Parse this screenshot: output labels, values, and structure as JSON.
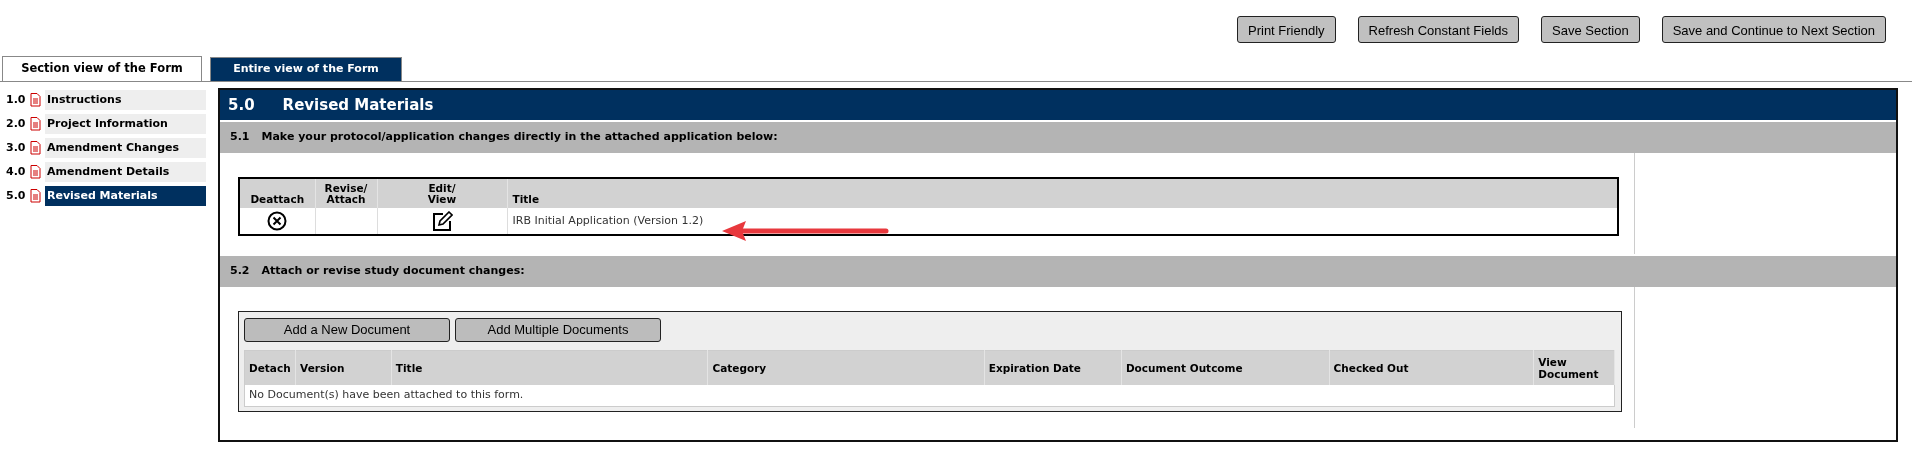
{
  "toolbar_buttons": [
    "Print Friendly",
    "Refresh Constant Fields",
    "Save Section",
    "Save and Continue to Next Section"
  ],
  "tabs": [
    {
      "label": "Section view of the Form",
      "selected": true
    },
    {
      "label": "Entire view of the Form",
      "selected": false
    }
  ],
  "sidebar": {
    "items": [
      {
        "number": "1.0",
        "label": "Instructions",
        "selected": false
      },
      {
        "number": "2.0",
        "label": "Project Information",
        "selected": false
      },
      {
        "number": "3.0",
        "label": "Amendment Changes",
        "selected": false
      },
      {
        "number": "4.0",
        "label": "Amendment Details",
        "selected": false
      },
      {
        "number": "5.0",
        "label": "Revised Materials",
        "selected": true
      }
    ]
  },
  "section": {
    "number": "5.0",
    "title": "Revised Materials",
    "subsections": [
      {
        "kind": "application",
        "number": "5.1",
        "title": "Make your protocol/application changes directly in the attached application below:",
        "columns": [
          "Deattach",
          "Revise/ Attach",
          "Edit/ View",
          "Title"
        ],
        "rows": [
          {
            "title": "IRB Initial Application (Version 1.2)"
          }
        ]
      },
      {
        "kind": "documents",
        "number": "5.2",
        "title": "Attach or revise study document changes:",
        "buttons": [
          "Add a New Document",
          "Add Multiple Documents"
        ],
        "columns": [
          "Detach",
          "Version",
          "Title",
          "Category",
          "Expiration Date",
          "Document Outcome",
          "Checked Out",
          "View Document"
        ],
        "empty_message": "No Document(s) have been attached to this form."
      }
    ]
  }
}
